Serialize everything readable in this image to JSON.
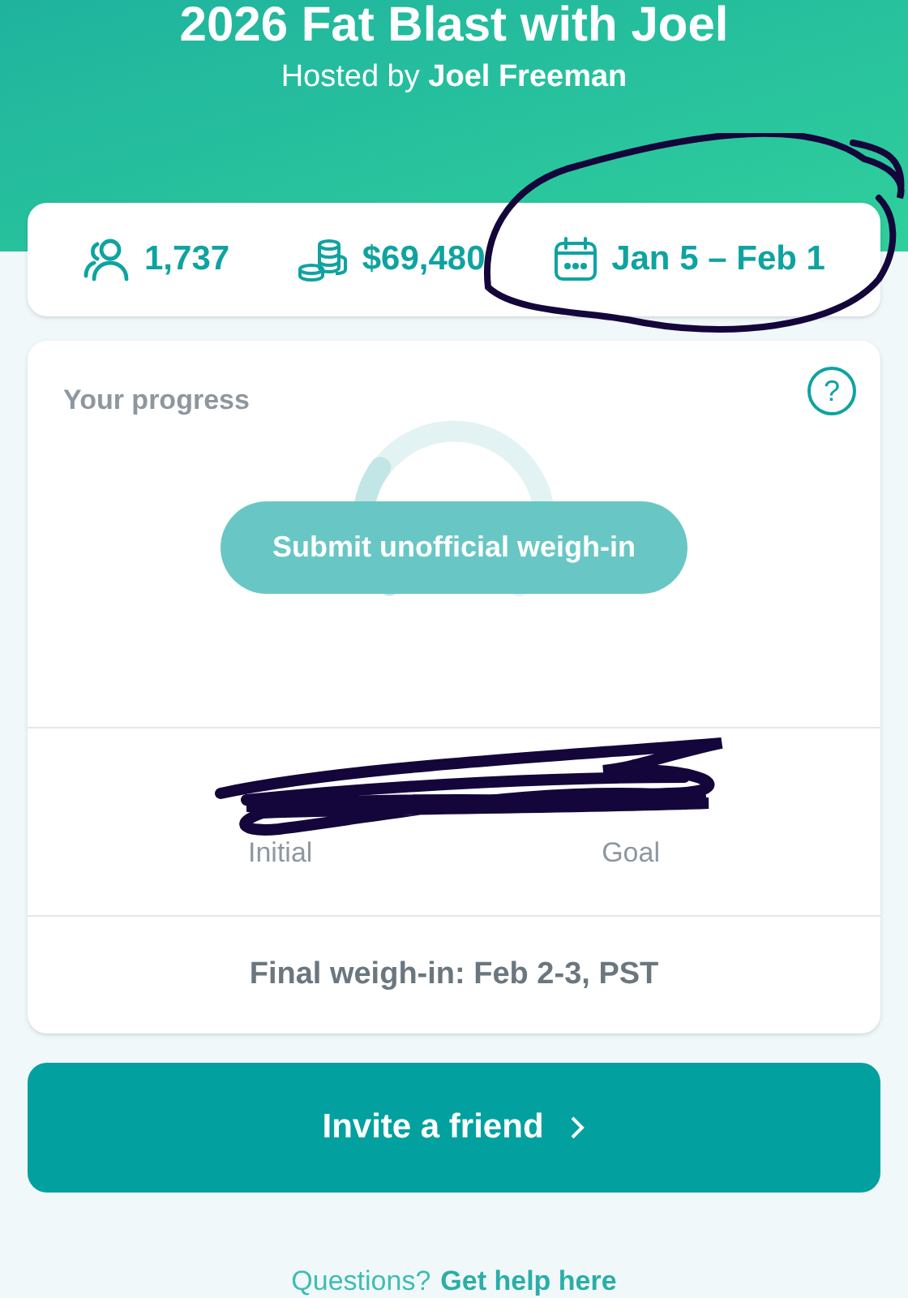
{
  "header": {
    "title": "2026 Fat Blast with Joel",
    "host": "Hosted by **Joel Freeman**"
  },
  "stats": [
    {
      "kind": "people",
      "value": "1,737"
    },
    {
      "kind": "money",
      "value": "$69,480"
    },
    {
      "kind": "calendar",
      "value": "Jan 5 – Feb 1"
    }
  ],
  "progress": {
    "title": "Your progress",
    "help": "?",
    "button": "Submit unofficial weigh-in",
    "weights": [
      {
        "label": "Initial"
      },
      {
        "label": "Goal"
      }
    ],
    "final": "Final weigh-in: Feb 2-3, PST"
  },
  "invite_button": "Invite a friend",
  "footer": {
    "prefix": "Questions?",
    "link": "Get help here"
  }
}
